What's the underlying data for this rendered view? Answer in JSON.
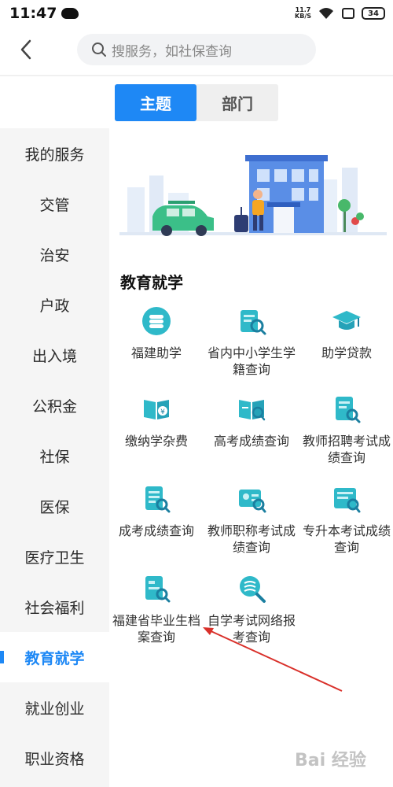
{
  "status_bar": {
    "time": "11:47",
    "net_speed_value": "11.7",
    "net_speed_unit": "KB/S",
    "battery": "34"
  },
  "header": {
    "search_placeholder": "搜服务，如社保查询"
  },
  "switch": {
    "tabs": [
      {
        "label": "主题",
        "active": true
      },
      {
        "label": "部门",
        "active": false
      }
    ]
  },
  "sidebar": {
    "items": [
      {
        "label": "我的服务"
      },
      {
        "label": "交管"
      },
      {
        "label": "治安"
      },
      {
        "label": "户政"
      },
      {
        "label": "出入境"
      },
      {
        "label": "公积金"
      },
      {
        "label": "社保"
      },
      {
        "label": "医保"
      },
      {
        "label": "医疗卫生"
      },
      {
        "label": "社会福利"
      },
      {
        "label": "教育就学",
        "active": true
      },
      {
        "label": "就业创业"
      },
      {
        "label": "职业资格"
      }
    ]
  },
  "section": {
    "title": "教育就学",
    "services": [
      {
        "label": "福建助学",
        "icon": "coin-stack-icon"
      },
      {
        "label": "省内中小学生学籍查询",
        "icon": "document-search-icon"
      },
      {
        "label": "助学贷款",
        "icon": "graduation-cap-icon"
      },
      {
        "label": "缴纳学杂费",
        "icon": "book-payment-icon"
      },
      {
        "label": "高考成绩查询",
        "icon": "exam-score-icon"
      },
      {
        "label": "教师招聘考试成绩查询",
        "icon": "document-search-icon"
      },
      {
        "label": "成考成绩查询",
        "icon": "document-search-icon"
      },
      {
        "label": "教师职称考试成绩查询",
        "icon": "id-card-search-icon"
      },
      {
        "label": "专升本考试成绩查询",
        "icon": "certificate-search-icon"
      },
      {
        "label": "福建省毕业生档案查询",
        "icon": "archive-search-icon"
      },
      {
        "label": "自学考试网络报考查询",
        "icon": "magnifier-icon"
      }
    ]
  },
  "watermark": "Bai 经验",
  "colors": {
    "accent": "#1e88f5",
    "icon_teal": "#2fb9c9",
    "annotation_arrow": "#d9302a"
  }
}
